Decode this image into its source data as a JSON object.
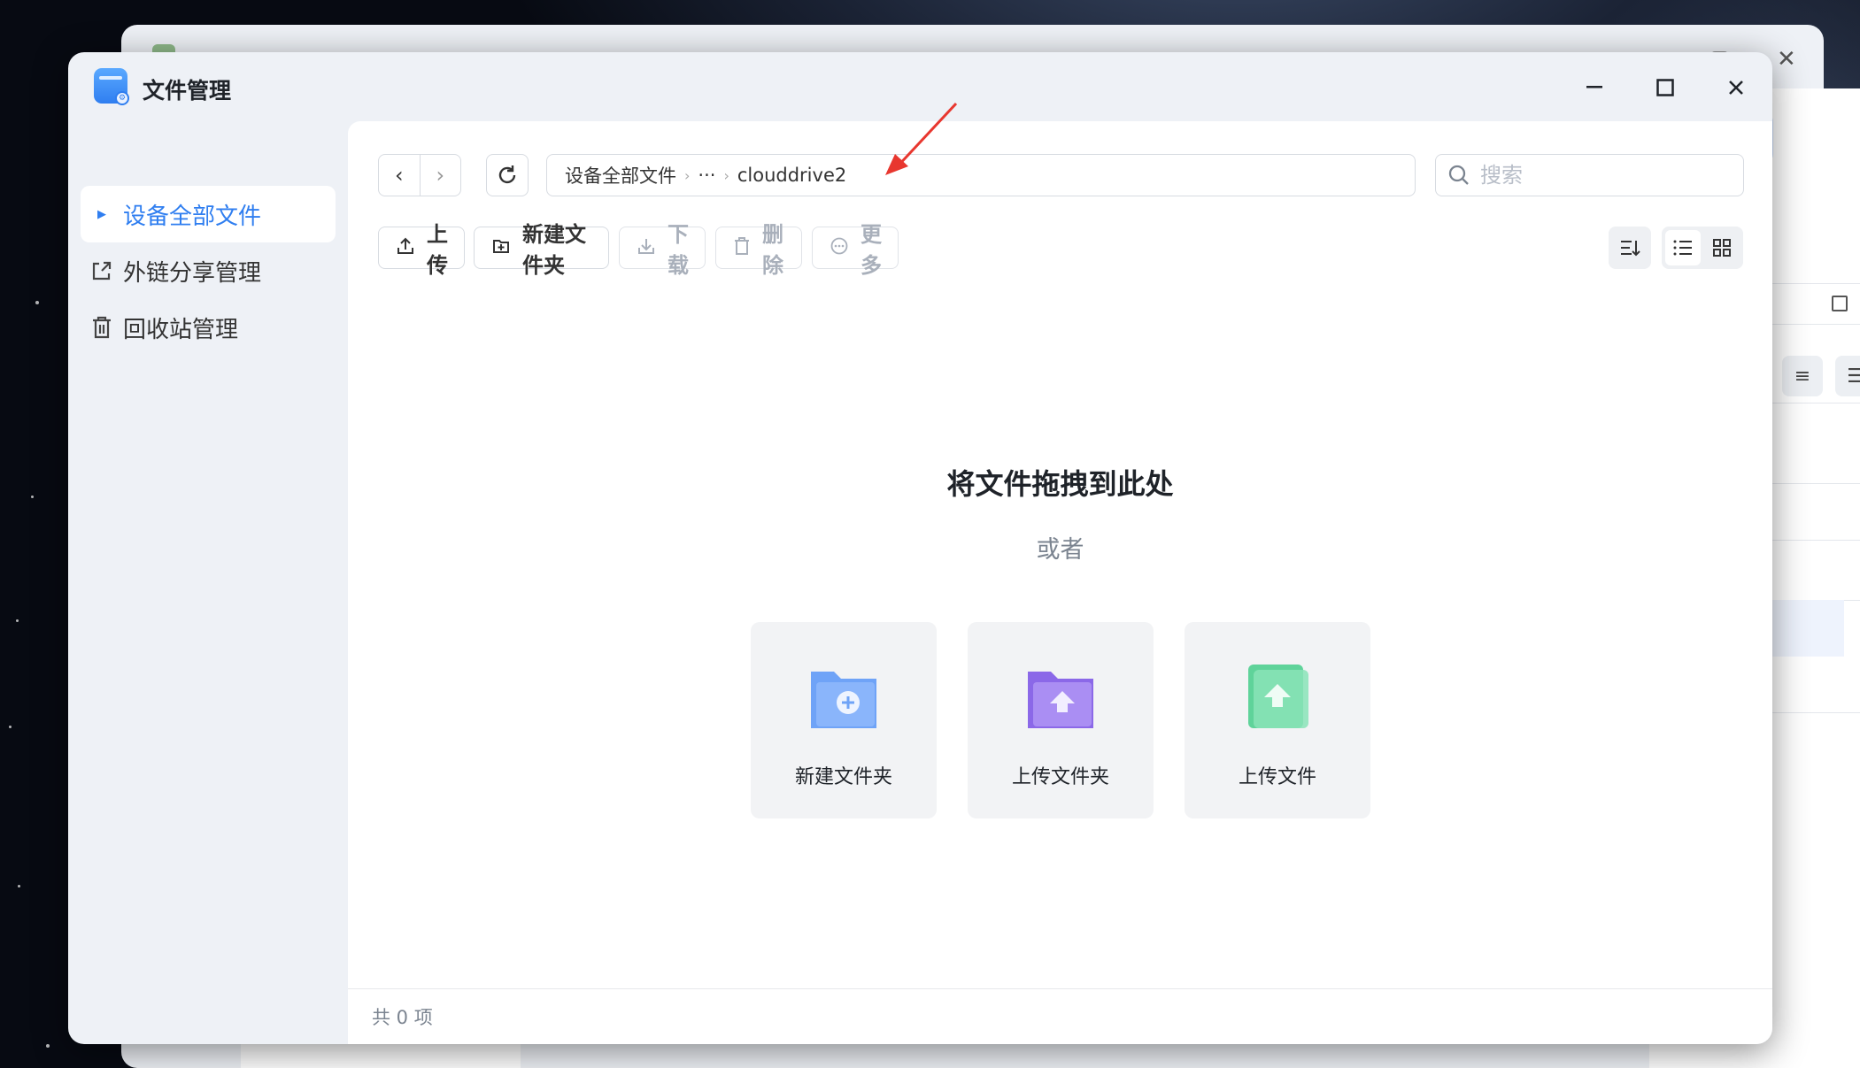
{
  "app": {
    "title": "文件管理"
  },
  "window_controls": {
    "minimize": "—",
    "maximize": "☐",
    "close": "✕"
  },
  "sidebar": {
    "items": [
      {
        "label": "设备全部文件",
        "active": true
      },
      {
        "label": "外链分享管理",
        "active": false
      },
      {
        "label": "回收站管理",
        "active": false
      }
    ]
  },
  "nav": {
    "back": "‹",
    "forward": "›"
  },
  "breadcrumb": {
    "root": "设备全部文件",
    "ellipsis": "···",
    "current": "clouddrive2"
  },
  "search": {
    "placeholder": "搜索"
  },
  "toolbar": {
    "upload": "上传",
    "new_folder": "新建文件夹",
    "download": "下载",
    "delete": "删除",
    "more": "更多"
  },
  "empty_state": {
    "title": "将文件拖拽到此处",
    "or": "或者",
    "cards": [
      {
        "label": "新建文件夹",
        "icon": "new-folder-icon",
        "color": "#6fa3f7"
      },
      {
        "label": "上传文件夹",
        "icon": "upload-folder-icon",
        "color": "#9a7bef"
      },
      {
        "label": "上传文件",
        "icon": "upload-file-icon",
        "color": "#5fd39a"
      }
    ]
  },
  "footer": {
    "count": "共 0 项"
  },
  "colors": {
    "accent": "#2f7ef0",
    "annotation_arrow": "#e8372f"
  }
}
